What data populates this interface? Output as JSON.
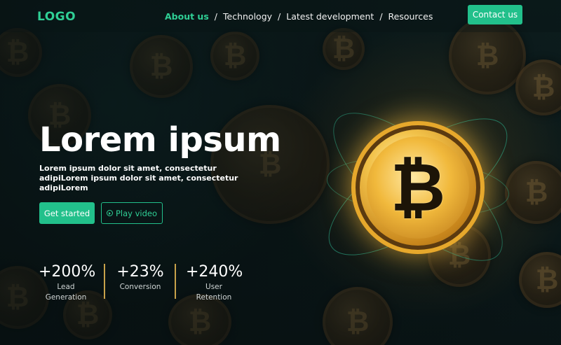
{
  "header": {
    "logo": "LOGO",
    "nav": [
      {
        "label": "About us",
        "active": true
      },
      {
        "label": "Technology",
        "active": false
      },
      {
        "label": "Latest development",
        "active": false
      },
      {
        "label": "Resources",
        "active": false
      }
    ],
    "separator": "/",
    "contact_label": "Contact us"
  },
  "hero": {
    "title": "Lorem ipsum",
    "subtitle": "Lorem ipsum dolor sit amet, consectetur adipiLorem ipsum dolor sit amet, consectetur adipiLorem",
    "primary_button": "Get started",
    "secondary_button": "Play video"
  },
  "stats": [
    {
      "value": "+200%",
      "label_line1": "Lead",
      "label_line2": "Generation"
    },
    {
      "value": "+23%",
      "label_line1": "Conversion",
      "label_line2": ""
    },
    {
      "value": "+240%",
      "label_line1": "User",
      "label_line2": "Retention"
    }
  ],
  "colors": {
    "accent": "#22c08b",
    "accent_text": "#2fcf95",
    "divider": "#c8a24a",
    "background": "#0b1718"
  },
  "icons": {
    "play": "play-circle-icon",
    "hero_image": "bitcoin-coin-icon"
  }
}
